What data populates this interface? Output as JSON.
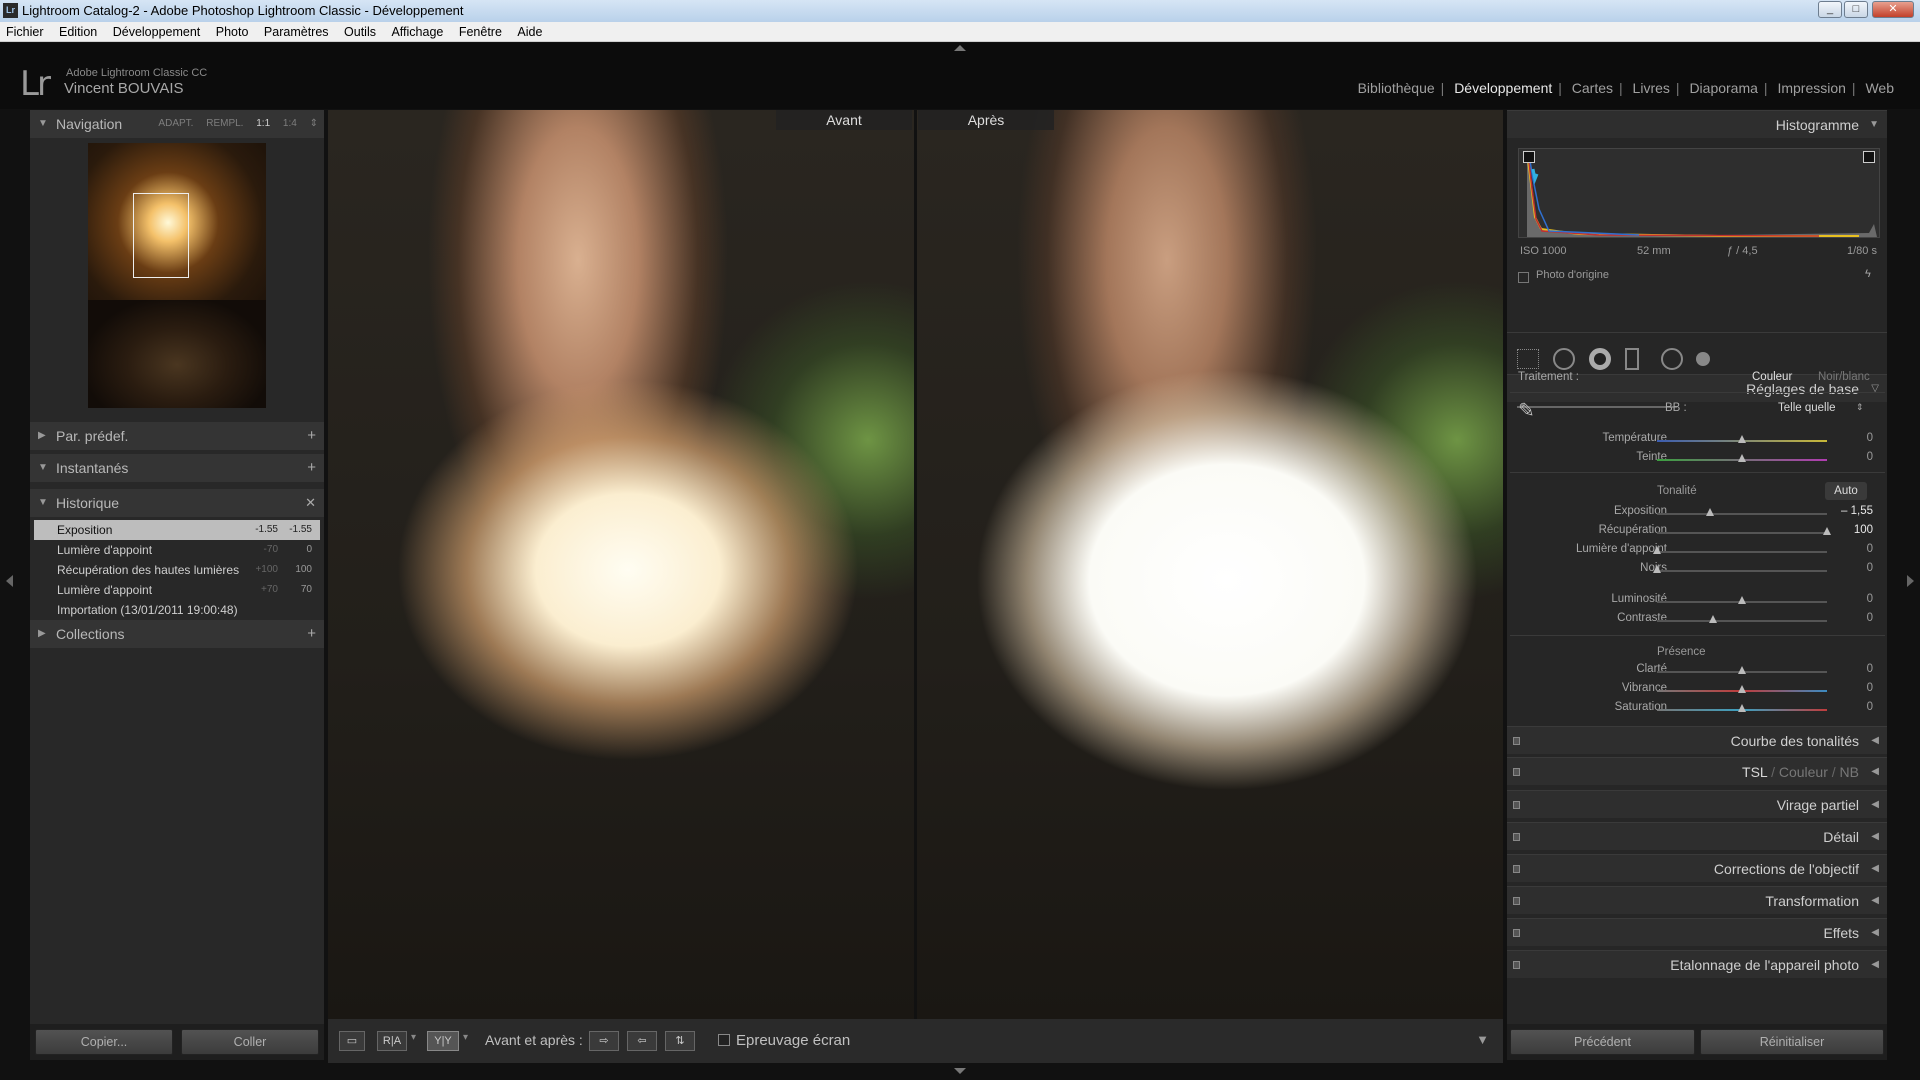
{
  "window": {
    "title": "Lightroom Catalog-2 - Adobe Photoshop Lightroom Classic - Développement",
    "icon": "Lr"
  },
  "menu": [
    "Fichier",
    "Edition",
    "Développement",
    "Photo",
    "Paramètres",
    "Outils",
    "Affichage",
    "Fenêtre",
    "Aide"
  ],
  "identity": {
    "logo": "Lr",
    "app_name": "Adobe Lightroom Classic CC",
    "user": "Vincent BOUVAIS"
  },
  "modules": [
    {
      "label": "Bibliothèque",
      "active": false
    },
    {
      "label": "Développement",
      "active": true
    },
    {
      "label": "Cartes",
      "active": false
    },
    {
      "label": "Livres",
      "active": false
    },
    {
      "label": "Diaporama",
      "active": false
    },
    {
      "label": "Impression",
      "active": false
    },
    {
      "label": "Web",
      "active": false
    }
  ],
  "left": {
    "navigation": {
      "title": "Navigation",
      "opts": [
        "ADAPT.",
        "REMPL.",
        "1:1",
        "1:4"
      ]
    },
    "presets": "Par. prédef.",
    "snapshots": "Instantanés",
    "history": {
      "title": "Historique",
      "items": [
        {
          "label": "Exposition",
          "before": "-1.55",
          "after": "-1.55",
          "selected": true
        },
        {
          "label": "Lumière d'appoint",
          "before": "-70",
          "after": "0"
        },
        {
          "label": "Récupération des hautes lumières",
          "before": "+100",
          "after": "100"
        },
        {
          "label": "Lumière d'appoint",
          "before": "+70",
          "after": "70"
        },
        {
          "label": "Importation (13/01/2011 19:00:48)",
          "before": "",
          "after": ""
        }
      ]
    },
    "collections": "Collections",
    "copy_btn": "Copier...",
    "paste_btn": "Coller"
  },
  "center": {
    "before_label": "Avant",
    "after_label": "Après"
  },
  "toolbar": {
    "before_after": "Avant et après :",
    "proof": "Epreuvage écran",
    "view_yy": "Y|Y"
  },
  "right": {
    "histogram": {
      "title": "Histogramme",
      "iso": "ISO 1000",
      "focal": "52 mm",
      "aperture": "ƒ / 4,5",
      "shutter": "1/80 s",
      "original": "Photo d'origine"
    },
    "basic": {
      "title": "Réglages de base",
      "treatment_label": "Traitement :",
      "color": "Couleur",
      "bw": "Noir/blanc",
      "wb_label": "BB :",
      "wb_value": "Telle quelle",
      "tone_label": "Tonalité",
      "auto": "Auto",
      "presence_label": "Présence",
      "sliders": {
        "temperature": {
          "label": "Température",
          "value": "0",
          "pos": 0.5
        },
        "teinte": {
          "label": "Teinte",
          "value": "0",
          "pos": 0.5
        },
        "exposition": {
          "label": "Exposition",
          "value": "– 1,55",
          "pos": 0.31
        },
        "recuperation": {
          "label": "Récupération",
          "value": "100",
          "pos": 1.0
        },
        "lumiere": {
          "label": "Lumière d'appoint",
          "value": "0",
          "pos": 0.0
        },
        "noirs": {
          "label": "Noirs",
          "value": "0",
          "pos": 0.0
        },
        "luminosite": {
          "label": "Luminosité",
          "value": "0",
          "pos": 0.5
        },
        "contraste": {
          "label": "Contraste",
          "value": "0",
          "pos": 0.33
        },
        "clarte": {
          "label": "Clarté",
          "value": "0",
          "pos": 0.5
        },
        "vibrance": {
          "label": "Vibrance",
          "value": "0",
          "pos": 0.5
        },
        "saturation": {
          "label": "Saturation",
          "value": "0",
          "pos": 0.5
        }
      }
    },
    "panels": {
      "courbe": "Courbe des tonalités",
      "tsl": "TSL",
      "tsl_sep": "/",
      "couleur": "Couleur",
      "nb": "NB",
      "virage": "Virage partiel",
      "detail": "Détail",
      "corrections": "Corrections de l'objectif",
      "transformation": "Transformation",
      "effets": "Effets",
      "etalonnage": "Etalonnage de l'appareil photo"
    },
    "prev_btn": "Précédent",
    "reset_btn": "Réinitialiser"
  }
}
